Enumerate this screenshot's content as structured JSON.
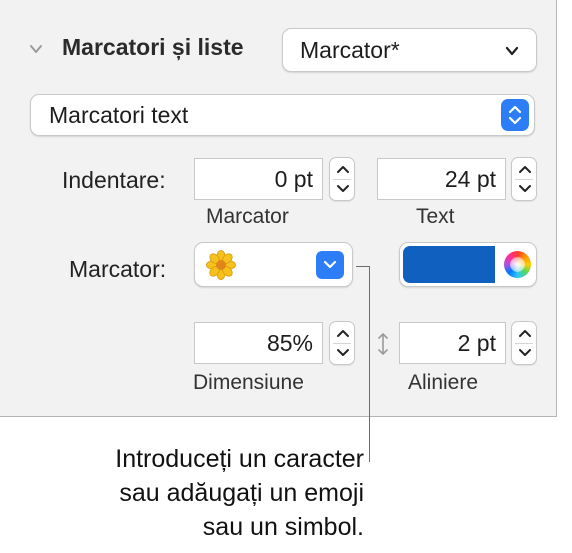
{
  "section": {
    "title": "Marcatori și liste"
  },
  "list_style_popup": {
    "value": "Marcator*"
  },
  "bullet_type_popup": {
    "value": "Marcatori text"
  },
  "indent": {
    "label": "Indentare:",
    "bullet_value": "0 pt",
    "bullet_caption": "Marcator",
    "text_value": "24 pt",
    "text_caption": "Text"
  },
  "bullet": {
    "label": "Marcator:",
    "symbol_icon": "flower-emoji",
    "color": "#1060bf"
  },
  "size": {
    "value": "85%",
    "caption": "Dimensiune"
  },
  "align": {
    "value": "2 pt",
    "caption": "Aliniere"
  },
  "callout": {
    "lines": [
      "Introduceți un caracter",
      "sau adăugați un emoji",
      "sau un simbol."
    ]
  }
}
